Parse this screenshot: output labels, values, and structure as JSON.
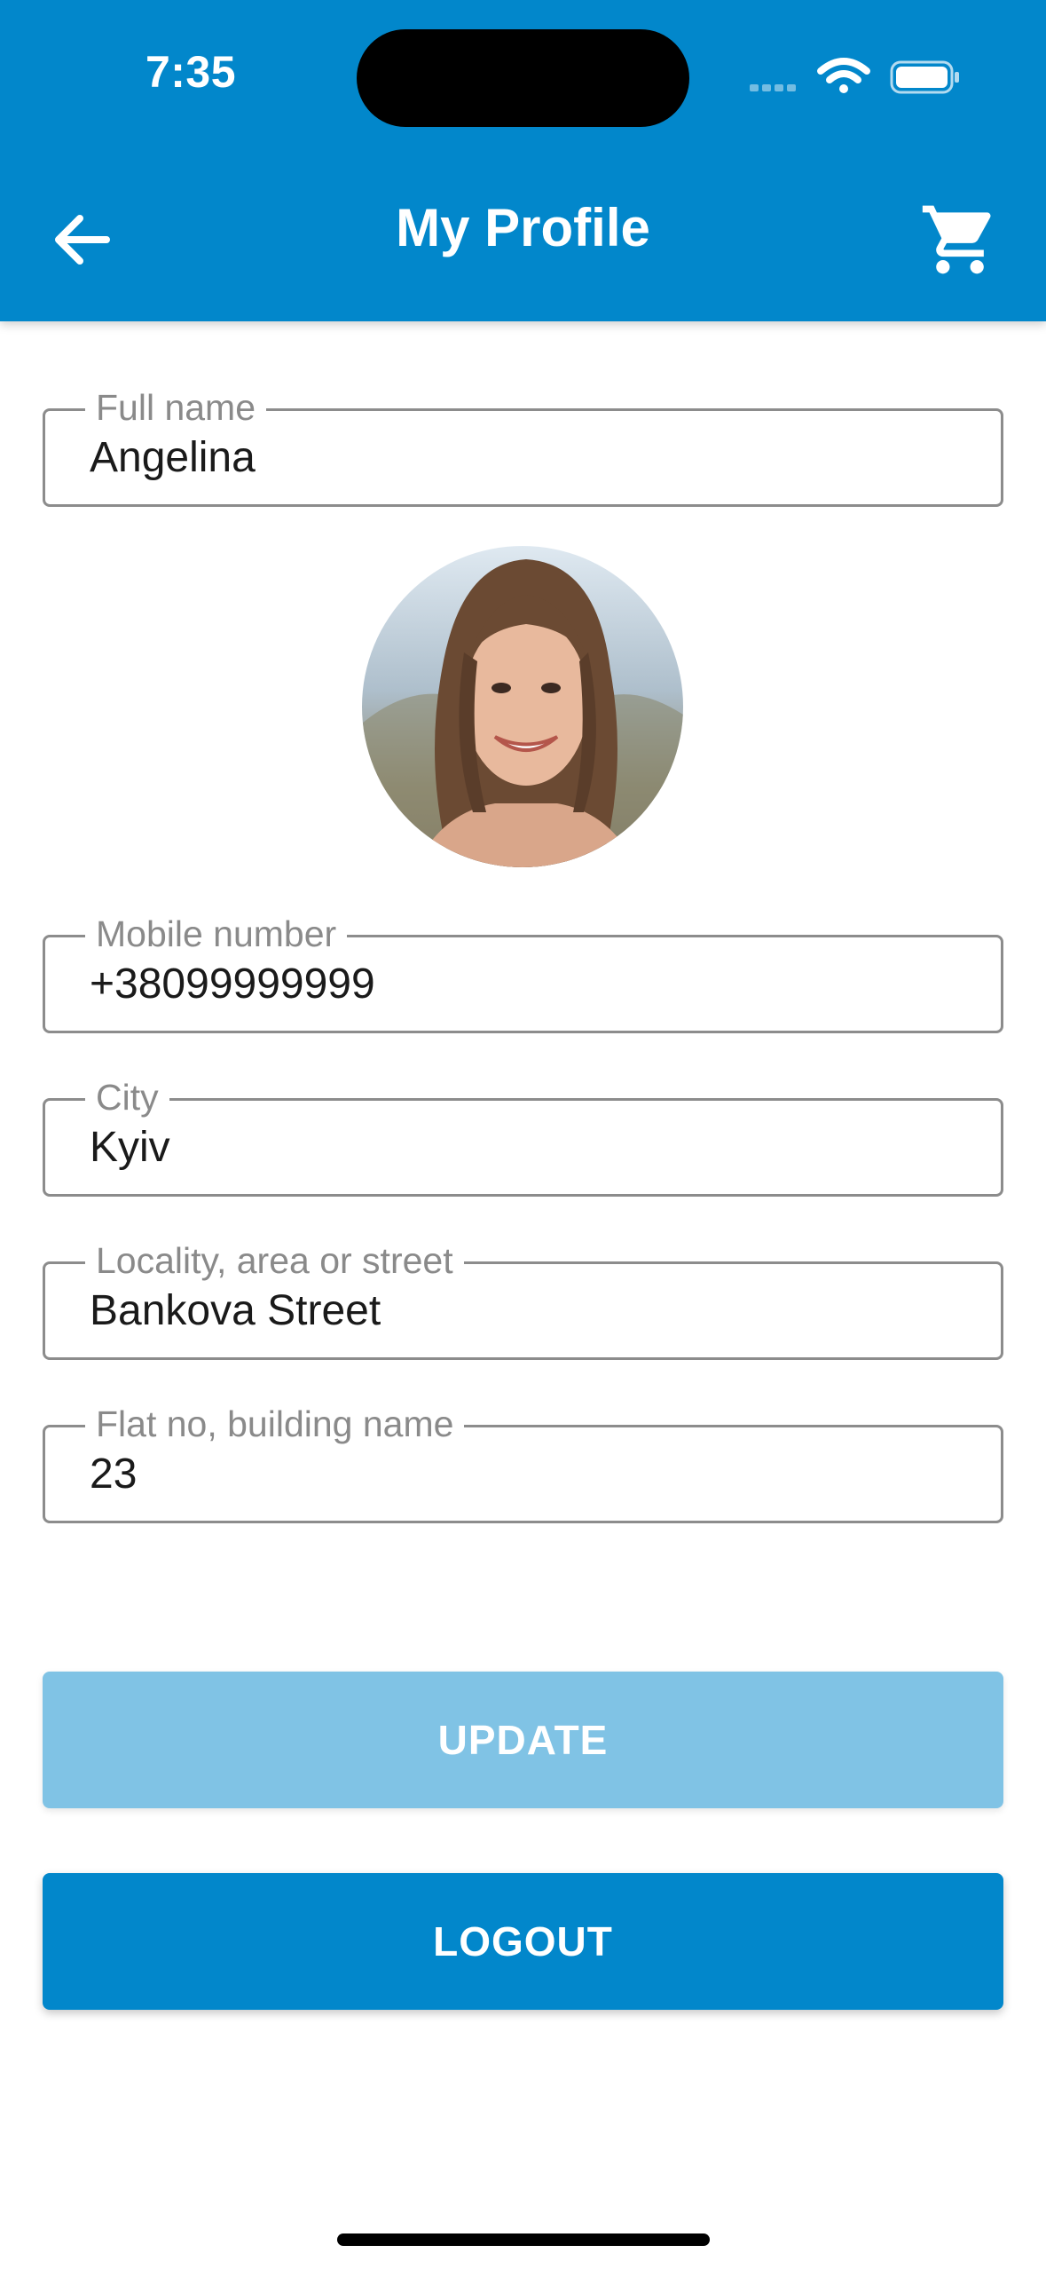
{
  "status_bar": {
    "time": "7:35",
    "icons": [
      "cellular-signal-icon",
      "wifi-icon",
      "battery-icon"
    ]
  },
  "header": {
    "title": "My Profile",
    "back_icon": "arrow-left-icon",
    "cart_icon": "shopping-cart-icon"
  },
  "form": {
    "full_name": {
      "label": "Full name",
      "value": "Angelina"
    },
    "mobile": {
      "label": "Mobile number",
      "value": "+38099999999"
    },
    "city": {
      "label": "City",
      "value": "Kyiv"
    },
    "locality": {
      "label": "Locality, area or street",
      "value": "Bankova Street"
    },
    "flat": {
      "label": "Flat no, building name",
      "value": "23"
    }
  },
  "buttons": {
    "update": "UPDATE",
    "logout": "LOGOUT"
  },
  "colors": {
    "primary": "#0287CB",
    "primary_disabled": "#80C3E5",
    "field_border": "#8c8c8c",
    "label": "#8a8a8a"
  }
}
